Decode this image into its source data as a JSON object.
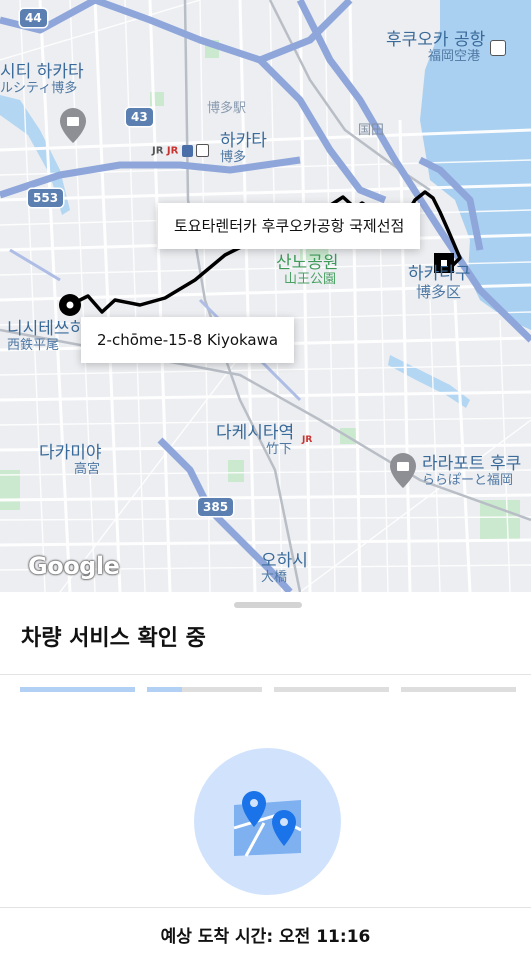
{
  "map": {
    "shields": [
      "44",
      "43",
      "553",
      "385"
    ],
    "labels": {
      "fukuoka_airport": {
        "ko": "후쿠오카 공항",
        "ja": "福岡空港"
      },
      "hakata_city": {
        "ko": "시티 하카타",
        "ja": "ルシティ博多"
      },
      "hakata_station_ja": "博多駅",
      "hakata": {
        "ko": "하카타",
        "ja": "博多"
      },
      "sanno_park": {
        "ko": "산노공원",
        "ja": "山王公園"
      },
      "hakata_ward": {
        "ko": "하카타구",
        "ja": "博多区"
      },
      "nishitetsu": {
        "ko": "니시테쓰히",
        "ja": "西鉄平尾"
      },
      "takamiya": {
        "ko": "다카미야",
        "ja": "高宮"
      },
      "takeshita": {
        "ko": "다케시타역",
        "ja": "竹下"
      },
      "lalaport": {
        "ko": "라라포트 후쿠",
        "ja": "ららぽーと福岡"
      },
      "ohashi": {
        "ko": "오하시",
        "ja": "大橋"
      },
      "shintakada": "国田"
    },
    "destination_callout": "토요타렌터카 후쿠오카공항 국제선점",
    "origin_callout": "2-chōme-15-8 Kiyokawa",
    "logo": "Google"
  },
  "sheet": {
    "status_title": "차량 서비스 확인 중",
    "progress": [
      1.0,
      0.3,
      0.0,
      0.0
    ],
    "eta_text": "예상 도착 시간: 오전 11:16"
  },
  "colors": {
    "accent_light": "#b2cff4",
    "illustration_bg": "#d1e3fc",
    "pin_blue": "#1a73e8",
    "route": "#000000",
    "highway": "#8fa6db"
  }
}
